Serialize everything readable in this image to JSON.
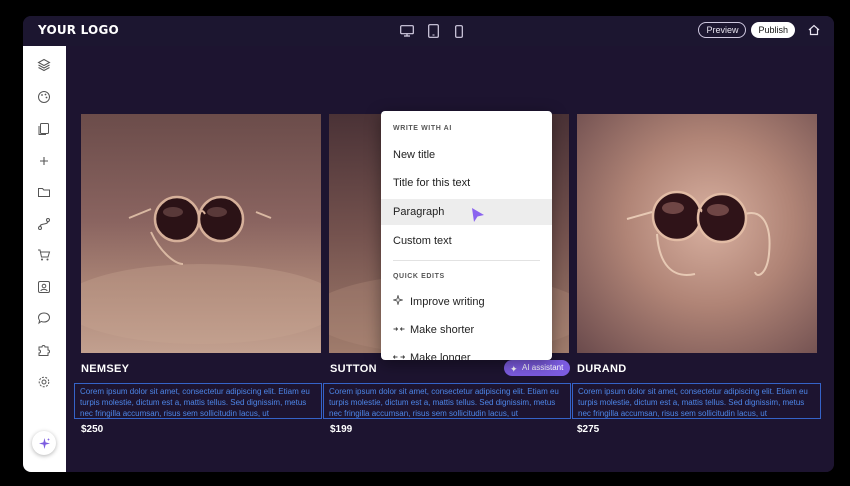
{
  "topbar": {
    "logo": "YOUR LOGO",
    "devices": [
      "desktop-icon",
      "tablet-icon",
      "mobile-icon"
    ],
    "preview_label": "Preview",
    "publish_label": "Publish"
  },
  "sidebar": {
    "icons": [
      "layers-icon",
      "palette-icon",
      "pages-icon",
      "add-icon",
      "folder-icon",
      "flow-icon",
      "cart-icon",
      "contact-icon",
      "chat-icon",
      "puzzle-icon",
      "settings-icon"
    ],
    "ai_button_icon": "sparkle-icon"
  },
  "menu": {
    "write_section": "WRITE WITH AI",
    "write_items": [
      "New title",
      "Title for this text",
      "Paragraph",
      "Custom text"
    ],
    "active_item": "Paragraph",
    "quick_section": "QUICK EDITS",
    "quick_items": [
      {
        "icon": "sparkle-outline-icon",
        "label": "Improve writing"
      },
      {
        "icon": "shorten-icon",
        "label": "Make shorter"
      },
      {
        "icon": "lengthen-icon",
        "label": "Make longer"
      }
    ]
  },
  "ai_badge": {
    "label": "AI assistant"
  },
  "products": [
    {
      "name": "NEMSEY",
      "description": "Corem ipsum dolor sit amet, consectetur adipiscing elit. Etiam eu turpis molestie, dictum est a, mattis tellus. Sed dignissim, metus nec fringilla accumsan, risus sem sollicitudin lacus, ut",
      "price": "$250"
    },
    {
      "name": "SUTTON",
      "description": "Corem ipsum dolor sit amet, consectetur adipiscing elit. Etiam eu turpis molestie, dictum est a, mattis tellus. Sed dignissim, metus nec fringilla accumsan, risus sem sollicitudin lacus, ut",
      "price": "$199"
    },
    {
      "name": "DURAND",
      "description": "Corem ipsum dolor sit amet, consectetur adipiscing elit. Etiam eu turpis molestie, dictum est a, mattis tellus. Sed dignissim, metus nec fringilla accumsan, risus sem sollicitudin lacus, ut",
      "price": "$275"
    }
  ],
  "colors": {
    "app_bg": "#1d1430",
    "accent": "#7c5ce0",
    "selection": "#3563c8"
  }
}
